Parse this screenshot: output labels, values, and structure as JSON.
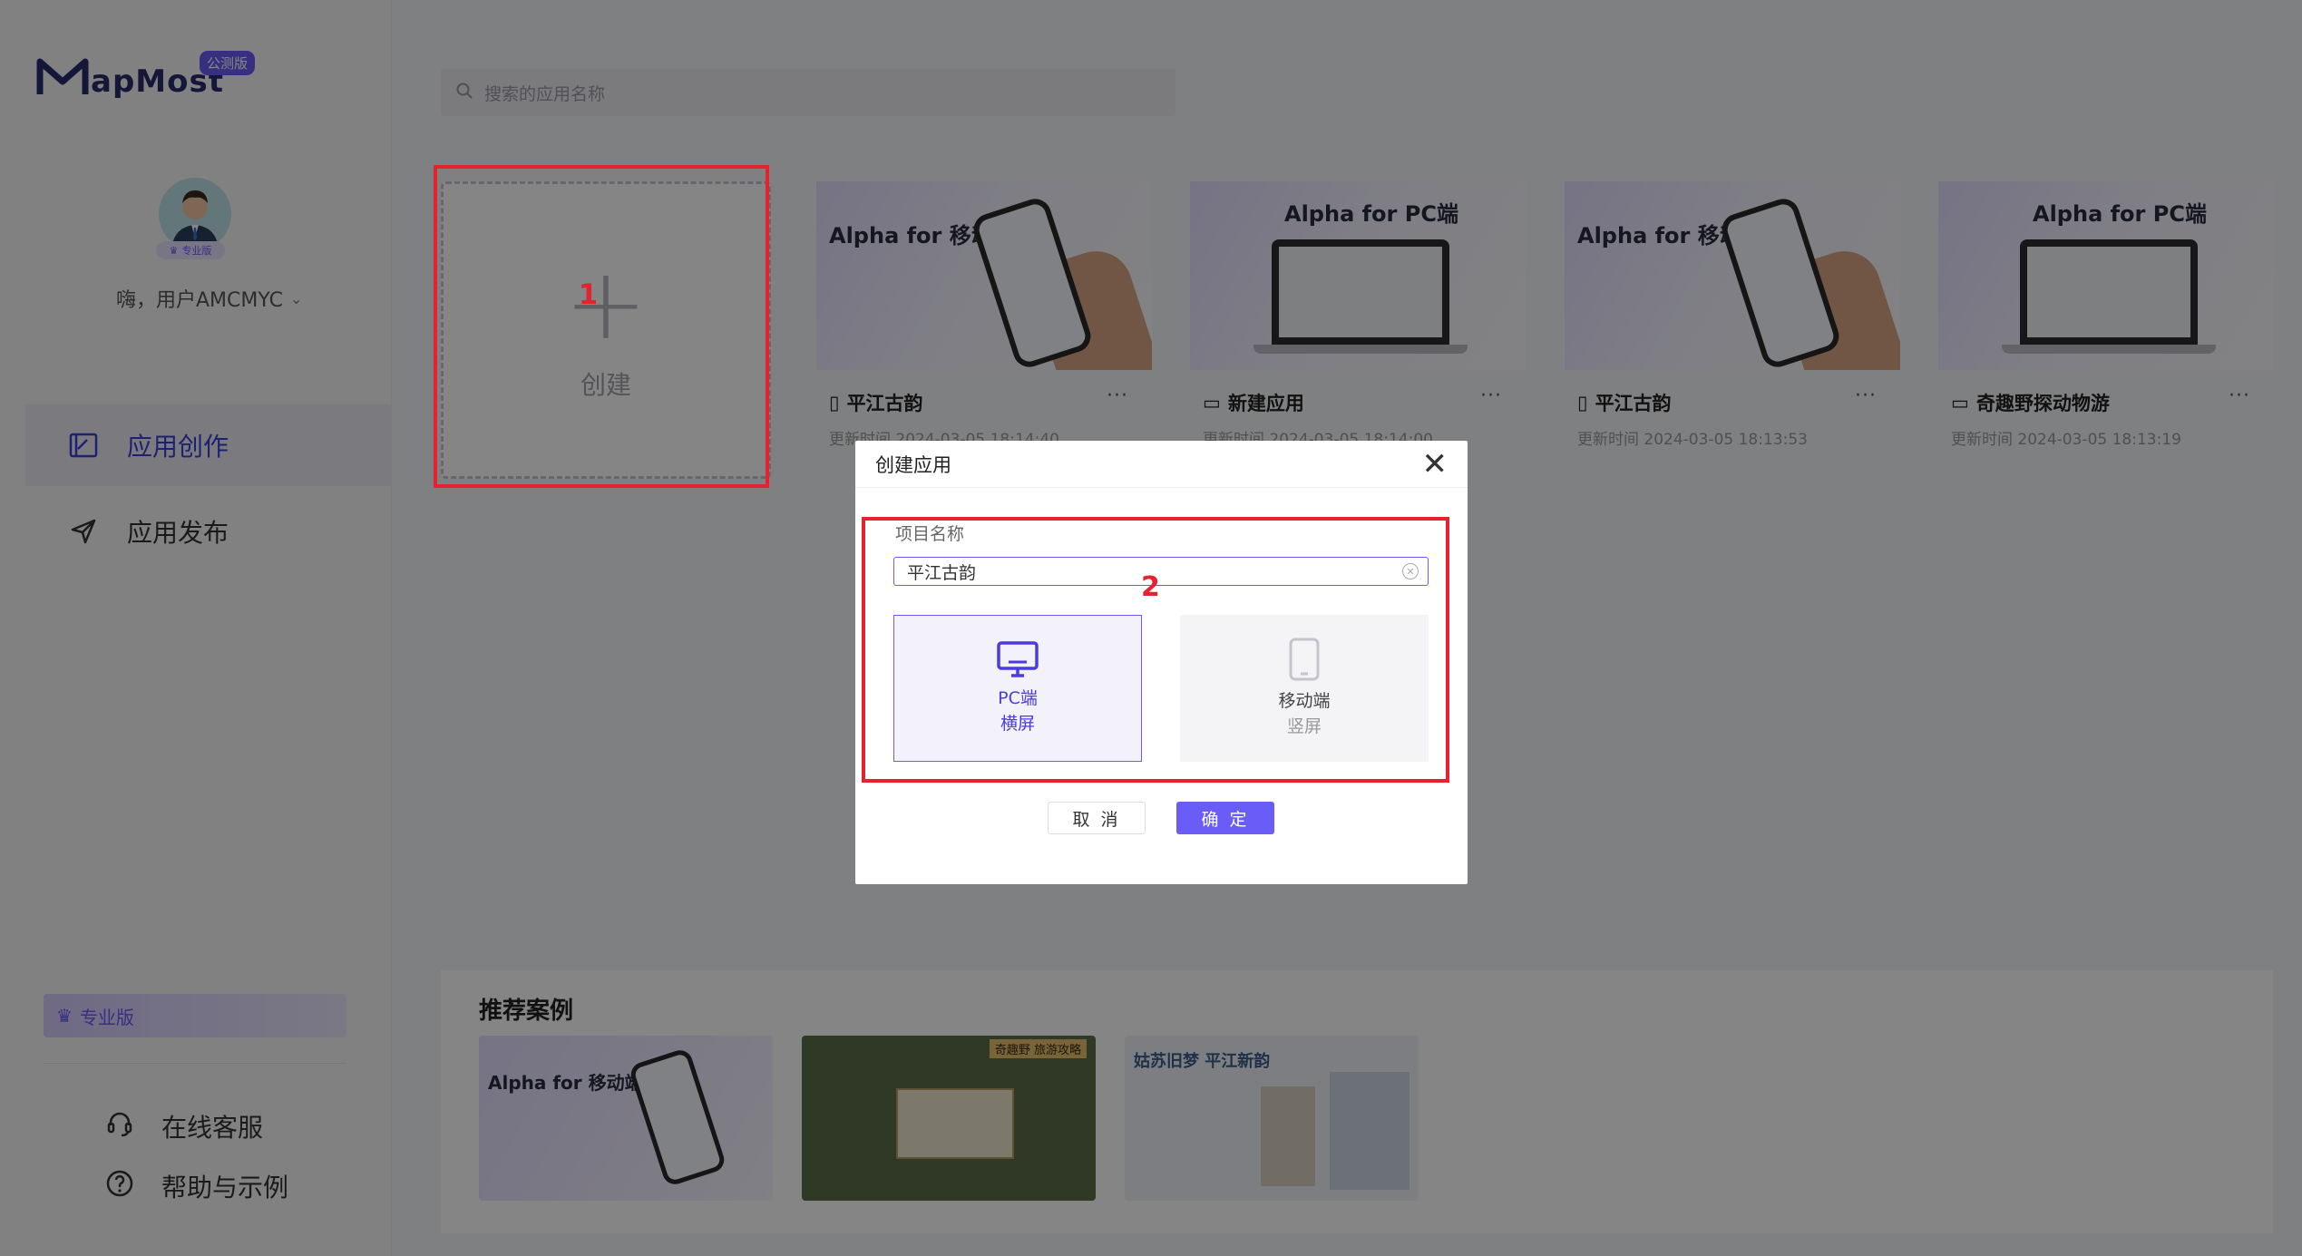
{
  "app": {
    "logo_text": "apMost",
    "logo_badge": "公测版",
    "search_placeholder": "搜索的应用名称"
  },
  "user": {
    "greeting": "嗨，用户AMCMYC",
    "avatar_badge": "专业版"
  },
  "sidebar": {
    "items": [
      {
        "label": "应用创作",
        "icon": "edit-board-icon",
        "active": true
      },
      {
        "label": "应用发布",
        "icon": "send-icon",
        "active": false
      }
    ],
    "pro_label": "专业版",
    "footer": [
      {
        "label": "在线客服",
        "icon": "headset-icon"
      },
      {
        "label": "帮助与示例",
        "icon": "help-circle-icon"
      }
    ]
  },
  "create_card": {
    "label": "创建",
    "marker": "1"
  },
  "apps": [
    {
      "name": "平江古韵",
      "device": "mobile",
      "thumb_title": "Alpha for 移动端",
      "time": "更新时间 2024-03-05 18:14:40"
    },
    {
      "name": "新建应用",
      "device": "pc",
      "thumb_title": "Alpha for PC端",
      "time": "更新时间 2024-03-05 18:14:00"
    },
    {
      "name": "平江古韵",
      "device": "mobile",
      "thumb_title": "Alpha for 移动端",
      "time": "更新时间 2024-03-05 18:13:53"
    },
    {
      "name": "奇趣野探动物游",
      "device": "pc",
      "thumb_title": "Alpha for PC端",
      "time": "更新时间 2024-03-05 18:13:19"
    }
  ],
  "recommended": {
    "title": "推荐案例",
    "items": [
      {
        "caption": "Alpha for 移动端"
      },
      {
        "caption": "奇趣野 旅游攻略"
      },
      {
        "caption": "姑苏旧梦 平江新韵"
      }
    ]
  },
  "modal": {
    "title": "创建应用",
    "field_label": "项目名称",
    "field_value": "平江古韵",
    "marker": "2",
    "options": [
      {
        "line1": "PC端",
        "line2": "横屏",
        "selected": true
      },
      {
        "line1": "移动端",
        "line2": "竖屏",
        "selected": false
      }
    ],
    "cancel_label": "取 消",
    "ok_label": "确 定"
  },
  "colors": {
    "accent": "#6a5cf6",
    "highlight_red": "#e5222e",
    "overlay": "rgba(0,0,0,0.48)"
  }
}
